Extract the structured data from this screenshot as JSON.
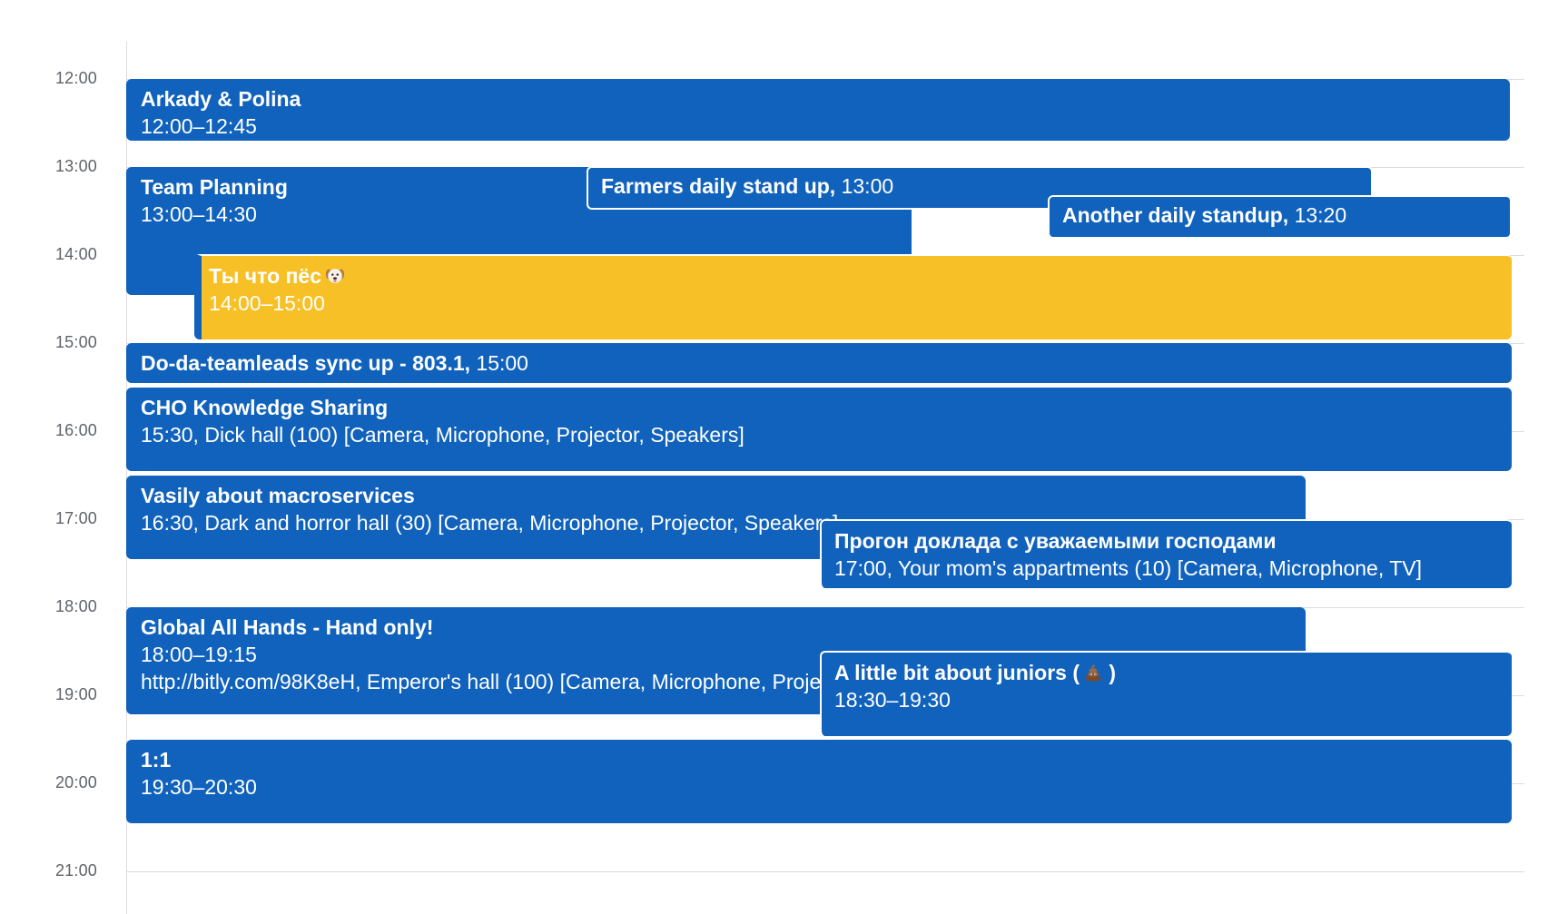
{
  "hours": [
    "12:00",
    "13:00",
    "14:00",
    "15:00",
    "16:00",
    "17:00",
    "18:00",
    "19:00",
    "20:00",
    "21:00"
  ],
  "colors": {
    "event_blue": "#1062bc",
    "event_yellow": "#f6c026",
    "grid": "#dadce0",
    "hour_text": "#5f6368"
  },
  "events": {
    "arkady": {
      "title": "Arkady & Polina",
      "time": "12:00–12:45"
    },
    "team_planning": {
      "title": "Team Planning",
      "time": "13:00–14:30"
    },
    "farmers": {
      "title": "Farmers daily stand up,",
      "time": " 13:00"
    },
    "another": {
      "title": "Another daily standup,",
      "time": " 13:20"
    },
    "dog": {
      "title": "Ты что пёс",
      "time": "14:00–15:00",
      "emoji": "dog-face-icon"
    },
    "doda": {
      "title": "Do-da-teamleads sync up - 803.1,",
      "time": " 15:00"
    },
    "cho": {
      "title": "CHO Knowledge Sharing",
      "details": "15:30, Dick hall (100) [Camera, Microphone, Projector, Speakers]"
    },
    "vasily": {
      "title": "Vasily about macroservices",
      "details": "16:30, Dark and horror hall (30) [Camera, Microphone, Projector, Speakers]"
    },
    "progon": {
      "title": "Прогон доклада с уважаемыми господами",
      "details": "17:00, Your mom's appartments (10) [Camera, Microphone, TV]"
    },
    "global": {
      "title": "Global All Hands - Hand only!",
      "time": "18:00–19:15",
      "details": "http://bitly.com/98K8eH, Emperor's hall (100) [Camera, Microphone, Projector, Speakers]"
    },
    "juniors": {
      "title": "A little bit about juniors (",
      "title_end": " )",
      "time": "18:30–19:30",
      "emoji": "pile-of-poo-icon"
    },
    "one_on_one": {
      "title": "1:1",
      "time": "19:30–20:30"
    }
  }
}
